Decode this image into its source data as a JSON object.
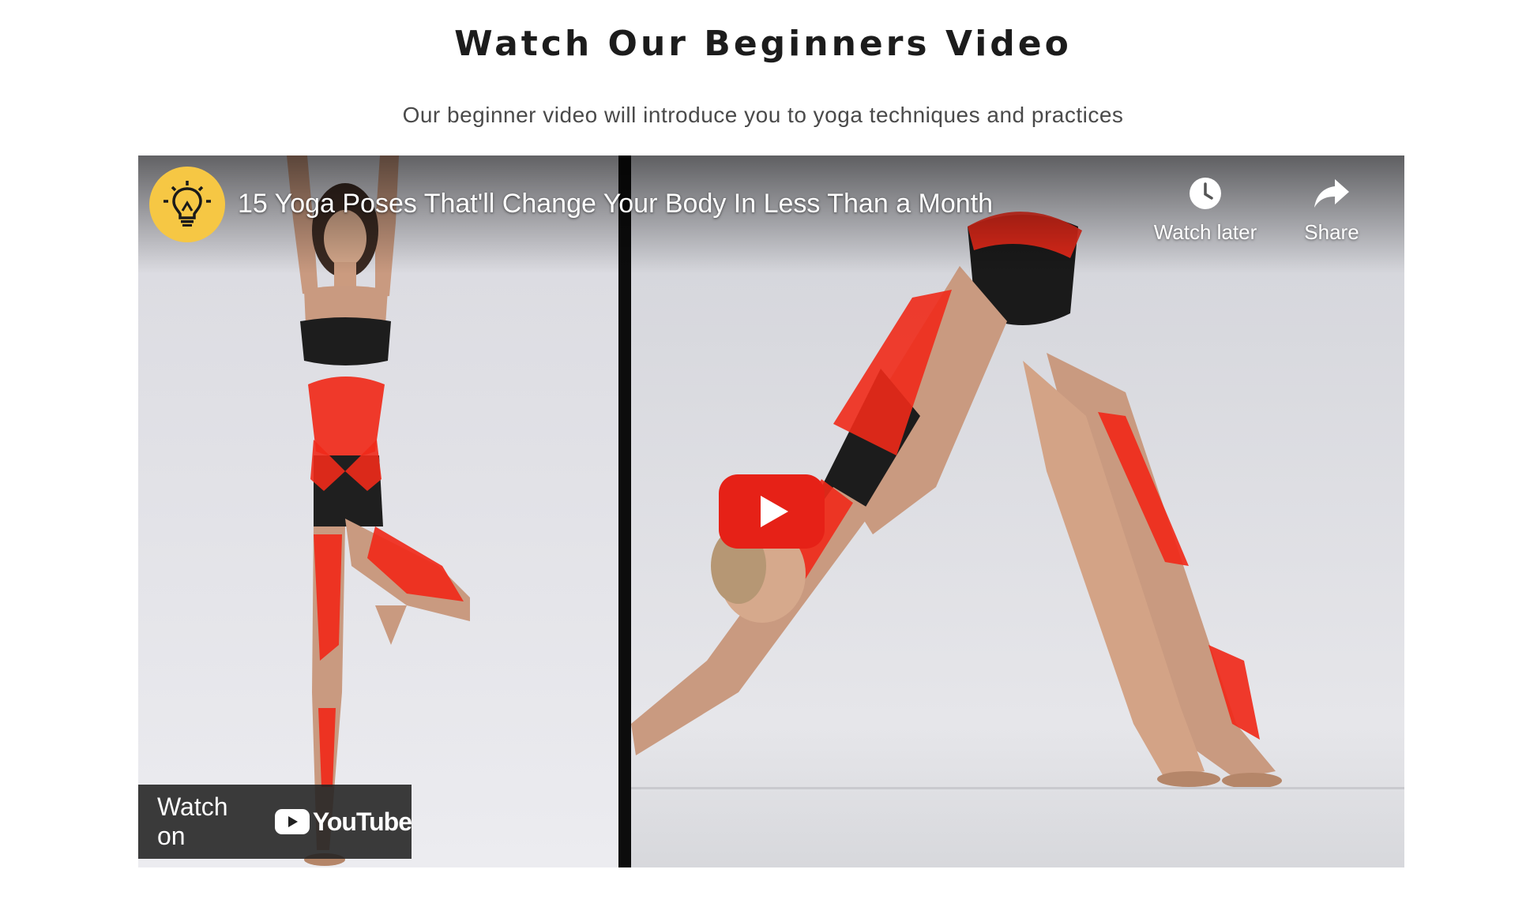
{
  "section": {
    "heading": "Watch Our Beginners Video",
    "subheading": "Our beginner video will introduce you to yoga techniques and practices"
  },
  "video": {
    "title": "15 Yoga Poses That'll Change Your Body In Less Than a Month",
    "channel_avatar_icon": "lightbulb-icon",
    "watch_later_label": "Watch later",
    "share_label": "Share",
    "watch_on_label": "Watch on",
    "youtube_wordmark": "YouTube",
    "colors": {
      "play_button": "#e62117",
      "highlight": "#f02a1a",
      "avatar": "#f6c744"
    }
  }
}
